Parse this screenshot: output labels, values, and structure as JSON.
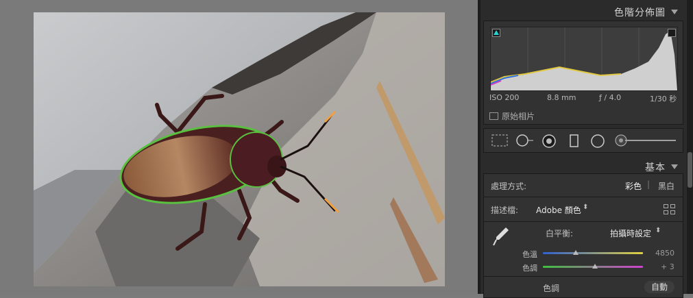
{
  "histogram": {
    "title": "色階分佈圖",
    "exif": {
      "iso": "ISO 200",
      "focal": "8.8 mm",
      "aperture": "ƒ / 4.0",
      "shutter": "1/30 秒"
    },
    "original_photo_label": "原始相片"
  },
  "basic": {
    "title": "基本",
    "treatment": {
      "label": "處理方式:",
      "color": "彩色",
      "separator": "|",
      "bw": "黑白"
    },
    "profile": {
      "label": "描述檔:",
      "value": "Adobe 顏色",
      "arrows": "⬍"
    },
    "wb": {
      "label": "白平衡:",
      "value": "拍攝時設定",
      "arrows": "⬍"
    },
    "temp": {
      "label": "色溫",
      "value": "4850",
      "position": 0.33
    },
    "tint": {
      "label": "色調",
      "value": "+ 3",
      "position": 0.52
    },
    "tone": {
      "label": "色調",
      "auto": "自動"
    }
  },
  "colors": {
    "panel": "#2b2b2b",
    "canvas": "#7a7a7a",
    "clip_shadow": "#2ad1d1"
  }
}
